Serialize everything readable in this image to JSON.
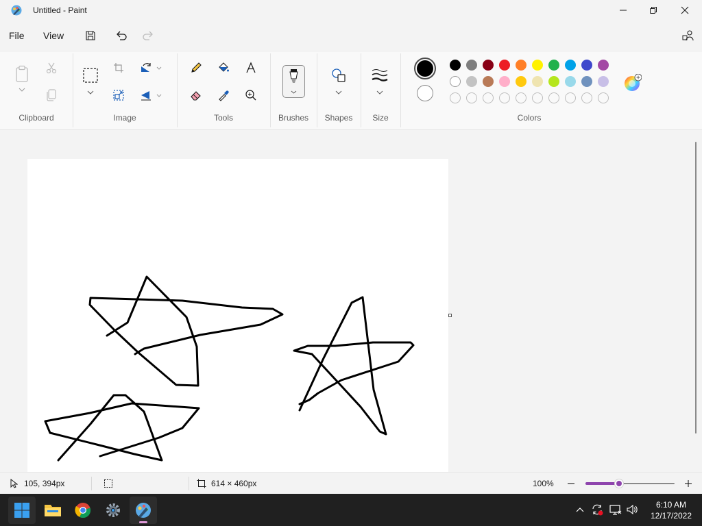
{
  "window": {
    "title": "Untitled - Paint",
    "controls": {
      "minimize": "minimize",
      "maximize": "restore",
      "close": "close"
    }
  },
  "menu": {
    "file_label": "File",
    "view_label": "View",
    "icons": [
      "save-icon",
      "undo-icon",
      "redo-icon",
      "share-icon"
    ]
  },
  "ribbon": {
    "groups": {
      "clipboard": "Clipboard",
      "image": "Image",
      "tools": "Tools",
      "brushes": "Brushes",
      "shapes": "Shapes",
      "size": "Size",
      "colors": "Colors"
    },
    "colors": {
      "primary": "#000000",
      "secondary": "#ffffff",
      "palette_row1": [
        "#000000",
        "#7f7f7f",
        "#880015",
        "#ed1c24",
        "#ff7f27",
        "#fff200",
        "#22b14c",
        "#00a2e8",
        "#3f48cc",
        "#a349a4"
      ],
      "palette_row2": [
        "#ffffff",
        "#c3c3c3",
        "#b97a57",
        "#ffaec9",
        "#ffc90e",
        "#efe4b0",
        "#b5e61d",
        "#99d9ea",
        "#7092be",
        "#c8bfe7"
      ],
      "palette_row3_custom_slots": 10
    }
  },
  "status": {
    "cursor_position": "105, 394px",
    "canvas_size": "614 × 460px",
    "zoom": "100%",
    "zoom_slider_fraction": 0.38
  },
  "taskbar": {
    "apps": [
      "start-icon",
      "file-explorer-icon",
      "chrome-icon",
      "settings-icon",
      "paint-icon"
    ],
    "clock": {
      "time": "6:10 AM",
      "date": "12/17/2022"
    }
  }
}
